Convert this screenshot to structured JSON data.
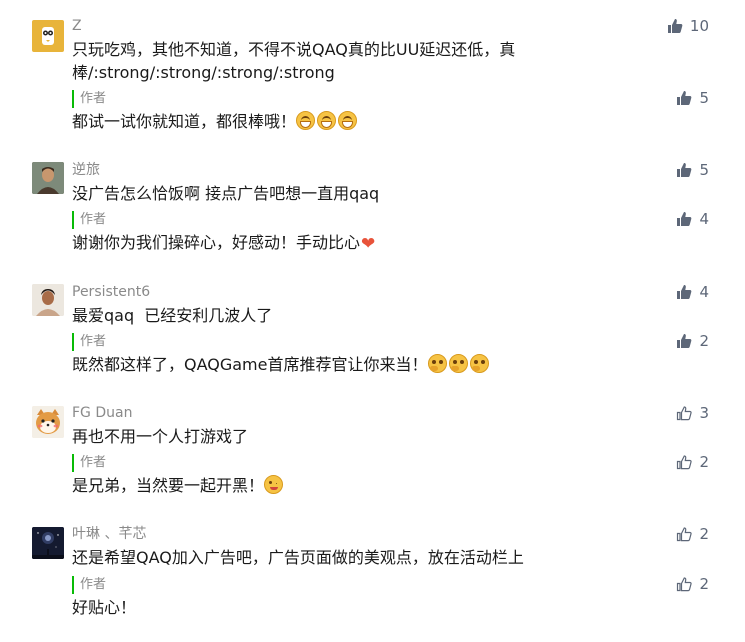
{
  "comments": [
    {
      "nickname": "Z",
      "text": "只玩吃鸡，其他不知道，不得不说QAQ真的比UU延迟还低，真棒/:strong/:strong/:strong/:strong",
      "likes": "10",
      "like_filled": true,
      "avatar_icon": "owl-avatar",
      "reply": {
        "tag": "作者",
        "text": "都试一试你就知道，都很棒哦！",
        "likes": "5",
        "like_filled": true,
        "emoji": [
          "grin-emoji",
          "grin-emoji",
          "grin-emoji"
        ]
      }
    },
    {
      "nickname": "逆旅",
      "text": "没广告怎么恰饭啊 接点广告吧想一直用qaq",
      "likes": "5",
      "like_filled": true,
      "avatar_icon": "man-portrait-avatar",
      "reply": {
        "tag": "作者",
        "text": "谢谢你为我们操碎心，好感动！手动比心",
        "likes": "4",
        "like_filled": true,
        "emoji": [
          "heart-emoji"
        ]
      }
    },
    {
      "nickname": "Persistent6",
      "text": "最爱qaq  已经安利几波人了",
      "likes": "4",
      "like_filled": true,
      "avatar_icon": "man-portrait-avatar",
      "reply": {
        "tag": "作者",
        "text": "既然都这样了，QAQGame首席推荐官让你来当！",
        "likes": "2",
        "like_filled": true,
        "emoji": [
          "thinking-emoji",
          "thinking-emoji",
          "thinking-emoji"
        ]
      }
    },
    {
      "nickname": "FG Duan",
      "text": "再也不用一个人打游戏了",
      "likes": "3",
      "like_filled": false,
      "avatar_icon": "shiba-dog-avatar",
      "reply": {
        "tag": "作者",
        "text": "是兄弟，当然要一起开黑！",
        "likes": "2",
        "like_filled": false,
        "emoji": [
          "wink-emoji"
        ]
      }
    },
    {
      "nickname": "叶琳 、芊芯",
      "text": "还是希望QAQ加入广告吧，广告页面做的美观点，放在活动栏上",
      "likes": "2",
      "like_filled": false,
      "avatar_icon": "night-sky-avatar",
      "reply": {
        "tag": "作者",
        "text": "好贴心！",
        "likes": "2",
        "like_filled": false,
        "emoji": []
      }
    }
  ],
  "colors": {
    "author_bar": "#09bb07",
    "like": "#5d6778",
    "nickname": "#8a8a8a"
  }
}
